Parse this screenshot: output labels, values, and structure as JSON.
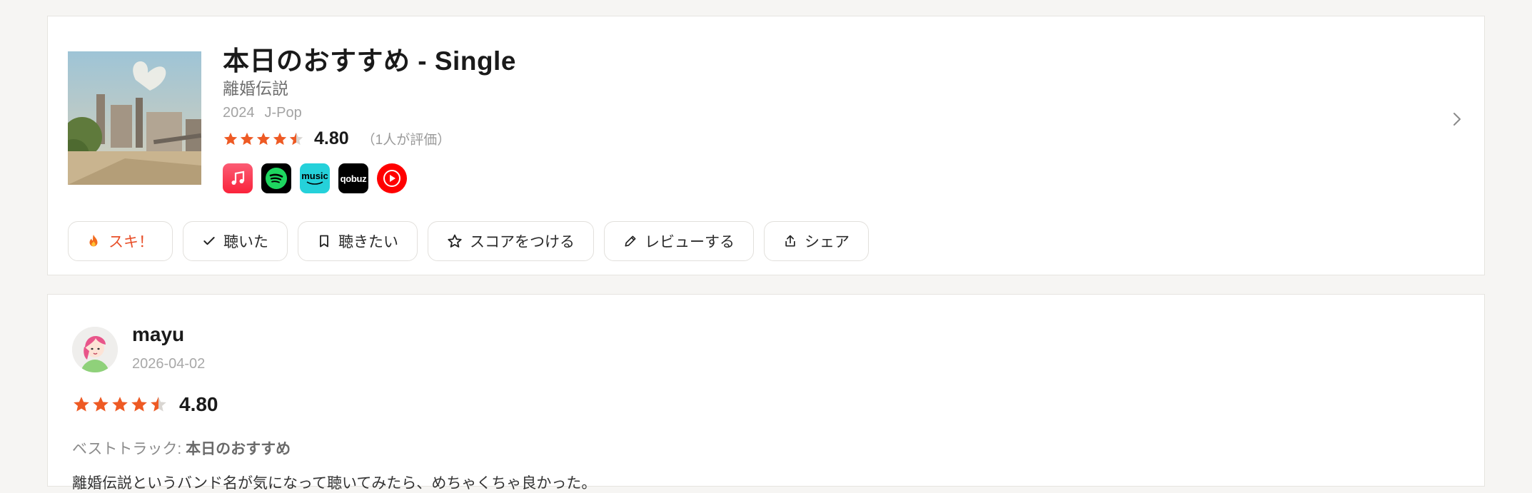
{
  "album": {
    "title": "本日のおすすめ - Single",
    "artist": "離婚伝説",
    "year": "2024",
    "genre": "J-Pop",
    "rating": "4.80",
    "rating_count": "（1人が評価）",
    "services": {
      "amazon_label": "music",
      "qobuz_label": "qobuz"
    },
    "actions": {
      "ski": "スキ！",
      "listened": "聴いた",
      "want": "聴きたい",
      "score": "スコアをつける",
      "review": "レビューする",
      "share": "シェア"
    }
  },
  "review": {
    "username": "mayu",
    "date": "2026-04-02",
    "rating": "4.80",
    "best_track_label": "ベストトラック: ",
    "best_track": "本日のおすすめ",
    "text": "離婚伝説というバンド名が気になって聴いてみたら、めちゃくちゃ良かった。"
  },
  "colors": {
    "accent": "#ee5a24",
    "background": "#f6f5f3"
  }
}
